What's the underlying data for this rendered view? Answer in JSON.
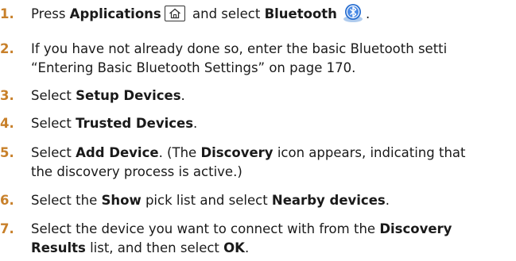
{
  "steps": [
    {
      "number": "1.",
      "prefix": "Press ",
      "bold1": "Applications",
      "icon1": "home-icon",
      "middle": " and select ",
      "bold2": "Bluetooth",
      "icon2": "bluetooth-icon",
      "suffix": "."
    },
    {
      "number": "2.",
      "line1": "If you have not already done so, enter the basic Bluetooth setti",
      "line2": "“Entering Basic Bluetooth Settings” on page 170."
    },
    {
      "number": "3.",
      "prefix": "Select ",
      "bold": "Setup Devices",
      "suffix": "."
    },
    {
      "number": "4.",
      "prefix": "Select ",
      "bold": "Trusted Devices",
      "suffix": "."
    },
    {
      "number": "5.",
      "prefix": "Select ",
      "bold": "Add Device",
      "middle": ". (The ",
      "bold2": "Discovery",
      "suffix": " icon appears, indicating that",
      "line2": "the discovery process is active.)"
    },
    {
      "number": "6.",
      "prefix": "Select the ",
      "bold": "Show",
      "middle": " pick list and select ",
      "bold2": "Nearby devices",
      "suffix": "."
    },
    {
      "number": "7.",
      "prefix": "Select the device you want to connect with from the ",
      "bold": "Discovery",
      "line2_bold": "Results",
      "line2_middle": " list, and then select ",
      "line2_bold2": "OK",
      "line2_suffix": "."
    }
  ],
  "colors": {
    "step_number": "#c8802a",
    "body_text": "#1a1a1a",
    "bluetooth_blue": "#2a6fd0"
  }
}
